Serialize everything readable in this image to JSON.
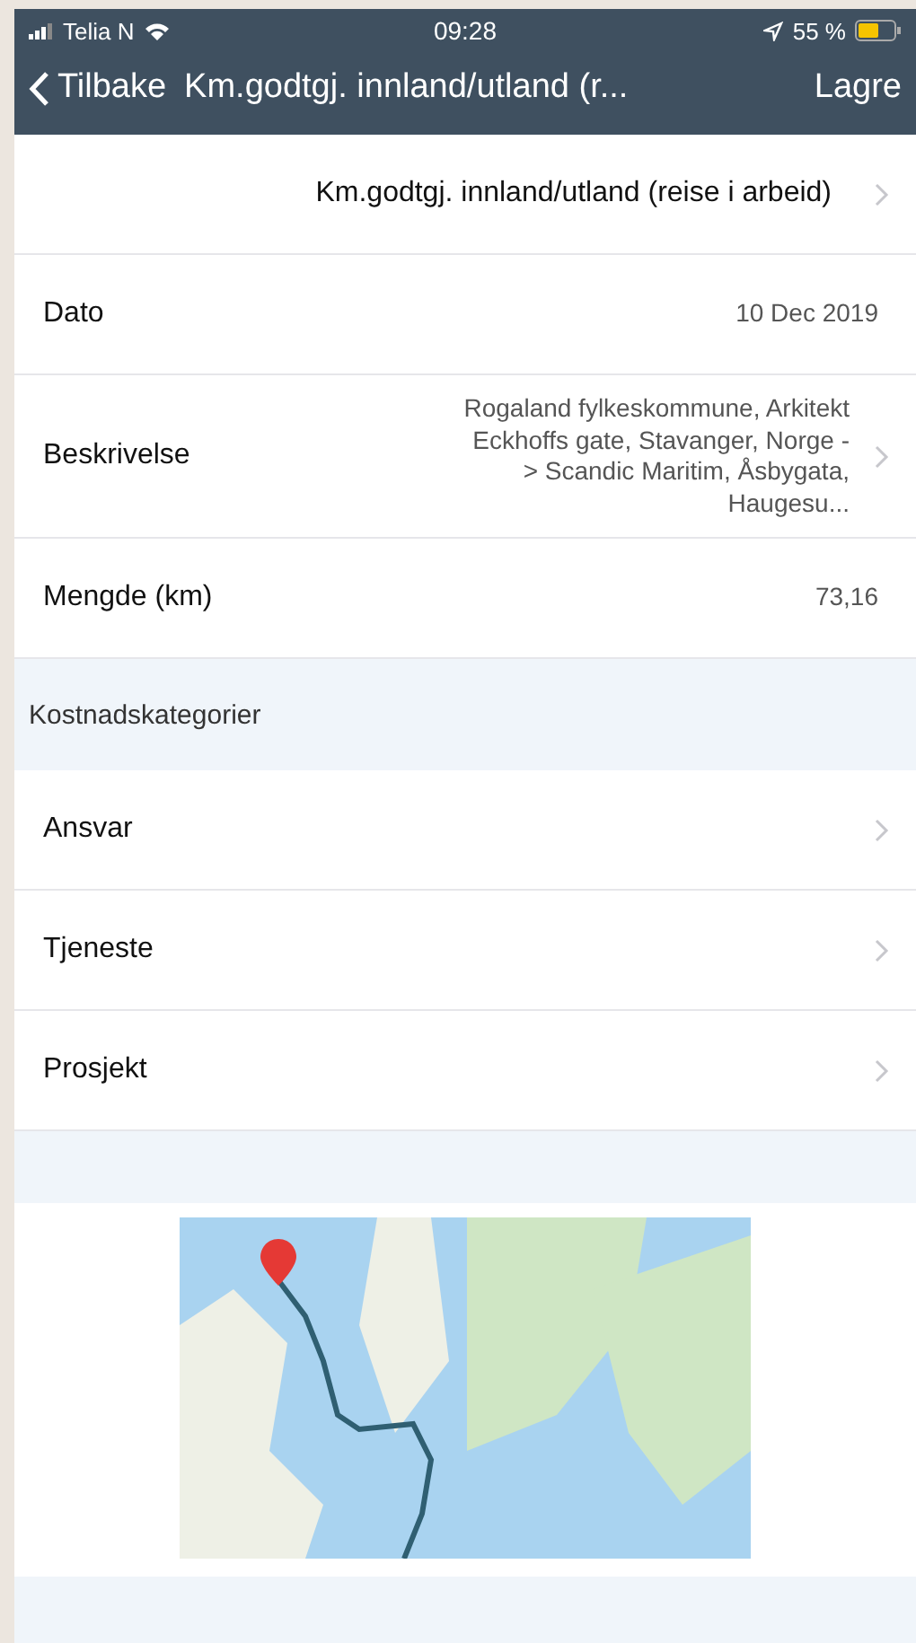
{
  "status_bar": {
    "carrier": "Telia N",
    "time": "09:28",
    "battery": "55 %"
  },
  "nav_bar": {
    "back": "Tilbake",
    "title": "Km.godtgj. innland/utland (r...",
    "action": "Lagre"
  },
  "header_row": {
    "text": "Km.godtgj. innland/utland (reise i arbeid)",
    "chevron": true
  },
  "rows": [
    {
      "label": "Dato",
      "value": "10 Dec 2019",
      "chevron": false
    },
    {
      "label": "Beskrivelse",
      "value": "Rogaland fylkeskommune, Arkitekt Eckhoffs gate, Stavanger, Norge -> Scandic Maritim, Åsbygata, Haugesu...",
      "chevron": true
    },
    {
      "label": "Mengde (km)",
      "value": "73,16",
      "chevron": false
    }
  ],
  "section": {
    "title": "Kostnadskategorier"
  },
  "category_rows": [
    {
      "label": "Ansvar",
      "chevron": true
    },
    {
      "label": "Tjeneste",
      "chevron": true
    },
    {
      "label": "Prosjekt",
      "chevron": true
    }
  ]
}
